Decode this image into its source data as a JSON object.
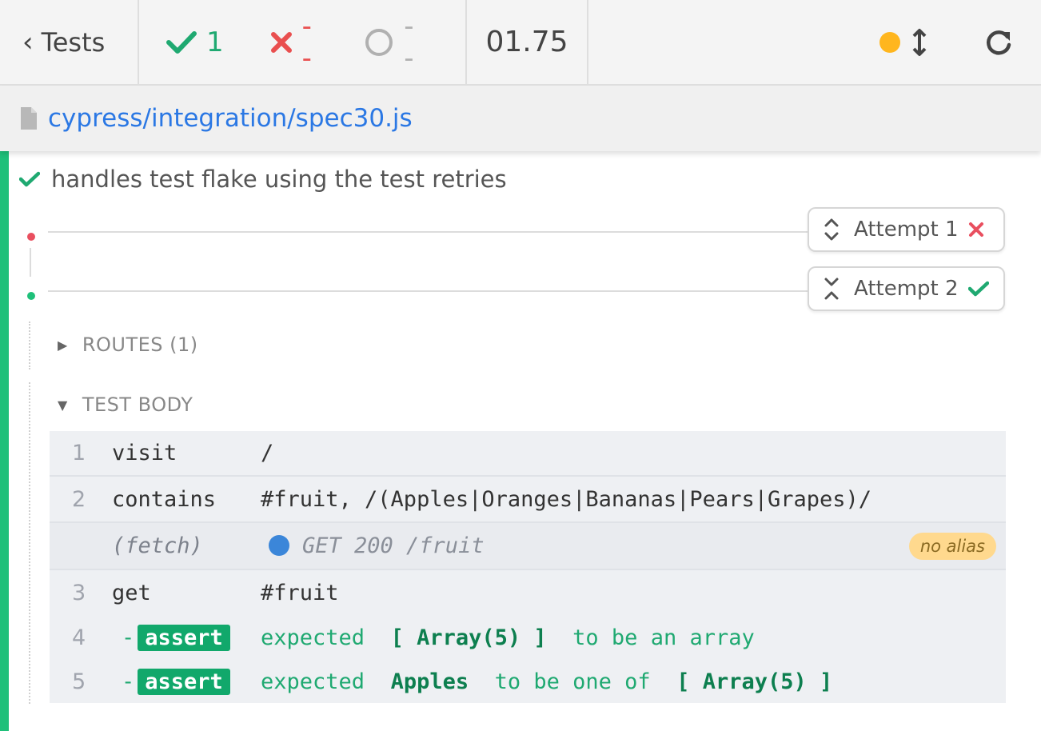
{
  "header": {
    "back_label": "Tests",
    "passed": "1",
    "failed": "--",
    "pending": "--",
    "duration": "01.75"
  },
  "spec": {
    "path": "cypress/integration/spec30.js"
  },
  "test": {
    "title": "handles test flake using the test retries"
  },
  "attempts": [
    {
      "label": "Attempt 1",
      "result": "failed",
      "dot_color": "#e94f5f"
    },
    {
      "label": "Attempt 2",
      "result": "passed",
      "dot_color": "#1fc07a"
    }
  ],
  "sections": {
    "routes": "ROUTES (1)",
    "test_body": "TEST BODY"
  },
  "commands": [
    {
      "num": "1",
      "name": "visit",
      "message": "/"
    },
    {
      "num": "2",
      "name": "contains",
      "message": "#fruit, /(Apples|Oranges|Bananas|Pears|Grapes)/"
    },
    {
      "name": "(fetch)",
      "message": "GET 200 /fruit",
      "alias": "no alias"
    },
    {
      "num": "3",
      "name": "get",
      "message": "#fruit"
    },
    {
      "num": "4",
      "dash": "-",
      "name": "assert",
      "msg_parts": [
        "expected",
        "[ Array(5) ]",
        "to be an array"
      ]
    },
    {
      "num": "5",
      "dash": "-",
      "name": "assert",
      "msg_parts": [
        "expected",
        "Apples",
        "to be one of",
        "[ Array(5) ]"
      ]
    }
  ],
  "colors": {
    "passed": "#1fa971",
    "failed": "#e94f4f",
    "running": "#ffb61e",
    "link": "#2b78e4",
    "fetch": "#3b86d9"
  }
}
